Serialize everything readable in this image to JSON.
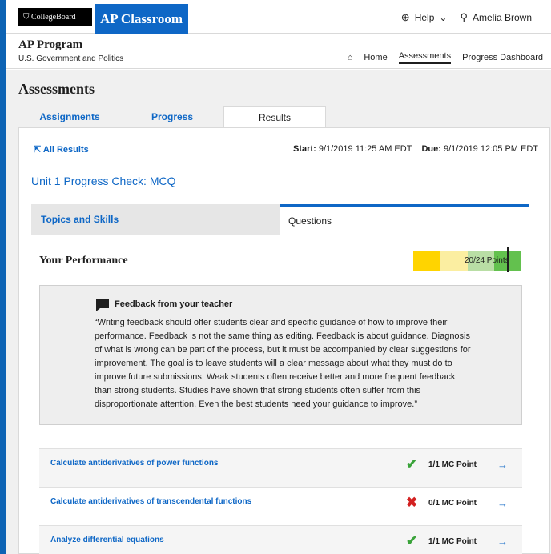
{
  "header": {
    "cb_logo": "CollegeBoard",
    "app_name": "AP Classroom",
    "help_label": "Help",
    "user_name": "Amelia Brown"
  },
  "program": {
    "title": "AP Program",
    "course": "U.S. Government and Politics",
    "nav": [
      "Home",
      "Assessments",
      "Progress Dashboard"
    ]
  },
  "page": {
    "title": "Assessments",
    "tabs": [
      "Assignments",
      "Progress",
      "Results"
    ],
    "all_results": "All Results",
    "start_label": "Start:",
    "start_value": "9/1/2019  11:25 AM EDT",
    "due_label": "Due:",
    "due_value": "9/1/2019   12:05 PM EDT",
    "check_title": "Unit 1 Progress Check: MCQ",
    "subtabs": [
      "Topics and Skills",
      "Questions"
    ],
    "performance_title": "Your Performance",
    "performance_text": "20/24 Points",
    "performance_fraction": 0.8333,
    "feedback_heading": "Feedback from your teacher",
    "feedback_text": "“Writing feedback should offer students clear and specific guidance of how to improve their performance. Feedback is not the same thing as editing. Feedback is about guidance. Diagnosis of what is wrong can be part of the process, but it must be accompanied by clear suggestions for improvement. The goal is to leave students will a clear message about what they must do to improve future submissions. Weak students often receive better and more frequent feedback than strong students. Studies have shown that strong students often suffer from this disproportionate attention. Even the best students need your guidance to improve.”",
    "rows": [
      {
        "name": "Calculate antiderivatives of power functions",
        "mark": "✔",
        "status": "ok",
        "points": "1/1 MC Point"
      },
      {
        "name": "Calculate antiderivatives of transcendental functions",
        "mark": "✖",
        "status": "bad",
        "points": "0/1 MC Point"
      },
      {
        "name": "Analyze differential equations",
        "mark": "✔",
        "status": "ok",
        "points": "1/1 MC Point"
      }
    ]
  },
  "colors": {
    "brand_blue": "#0e67c6",
    "ok_green": "#3aa33a",
    "error_red": "#d32121"
  }
}
